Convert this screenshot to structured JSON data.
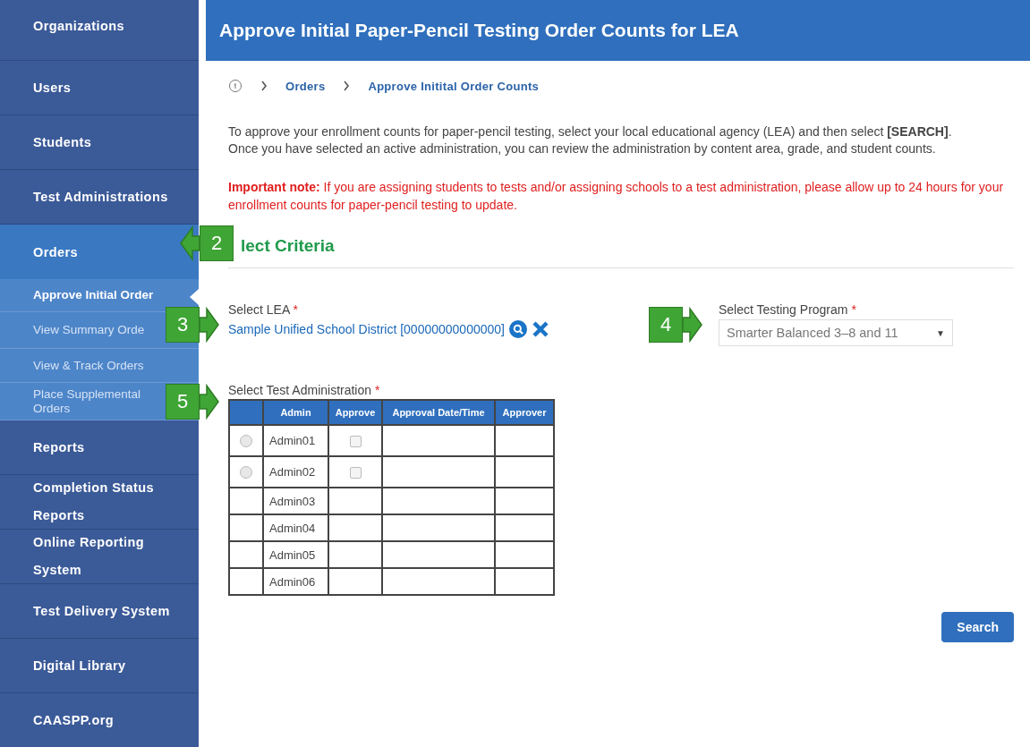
{
  "sidebar": {
    "items": [
      {
        "label": "Organizations",
        "selected": false
      },
      {
        "label": "Users",
        "selected": false
      },
      {
        "label": "Students",
        "selected": false
      },
      {
        "label": "Test Administrations",
        "selected": false
      },
      {
        "label": "Orders",
        "selected": true,
        "children": [
          {
            "label": "Approve Initial Order",
            "selected": true
          },
          {
            "label": "View Summary Orde",
            "selected": false
          },
          {
            "label": "View & Track Orders",
            "selected": false
          },
          {
            "label": "Place Supplemental Orders",
            "selected": false
          }
        ]
      },
      {
        "label": "Reports",
        "selected": false
      },
      {
        "label": "Completion Status Reports",
        "selected": false
      },
      {
        "label": "Online Reporting System",
        "selected": false
      },
      {
        "label": "Test Delivery System",
        "selected": false
      },
      {
        "label": "Digital Library",
        "selected": false
      },
      {
        "label": "CAASPP.org",
        "selected": false
      }
    ]
  },
  "page_title": "Approve Initial Paper-Pencil Testing Order Counts for LEA",
  "breadcrumb": [
    "Orders",
    "Approve Initital Order Counts"
  ],
  "intro": "To approve your enrollment counts for paper-pencil testing, select your local educational agency (LEA) and then select **[SEARCH]**. Once you have selected an active administration, you can review the administration by content area, grade, and student counts.",
  "note": "**Important note:** If you are assigning students to tests and/or assigning schools to a test administration, please allow up to 24 hours for your enrollment counts for paper-pencil testing to update.",
  "section_title": "lect Criteria",
  "lea": {
    "label": "Select LEA",
    "required": "*",
    "value": "Sample Unified School District [00000000000000]"
  },
  "program": {
    "label": "Select Testing Program",
    "required": "*",
    "value": "Smarter Balanced 3–8 and 11",
    "caret": "▼"
  },
  "admin": {
    "label": "Select Test Administration",
    "required": "*",
    "columns": [
      "Admin",
      "Approve",
      "Approval Date/Time",
      "Approver"
    ],
    "rows": [
      {
        "kind": "selectable",
        "name": "Admin01",
        "selected": false,
        "checked": false
      },
      {
        "kind": "selectable",
        "name": "Admin02",
        "selected": false,
        "checked": false
      },
      {
        "kind": "plain",
        "name": "Admin03"
      },
      {
        "kind": "plain",
        "name": "Admin04"
      },
      {
        "kind": "plain",
        "name": "Admin05"
      },
      {
        "kind": "plain",
        "name": "Admin06"
      }
    ]
  },
  "search_button": "Search",
  "callouts": [
    {
      "number": "2",
      "points_left": true
    },
    {
      "number": "3",
      "points_left": false
    },
    {
      "number": "4",
      "points_left": false
    },
    {
      "number": "5",
      "points_left": false
    }
  ]
}
